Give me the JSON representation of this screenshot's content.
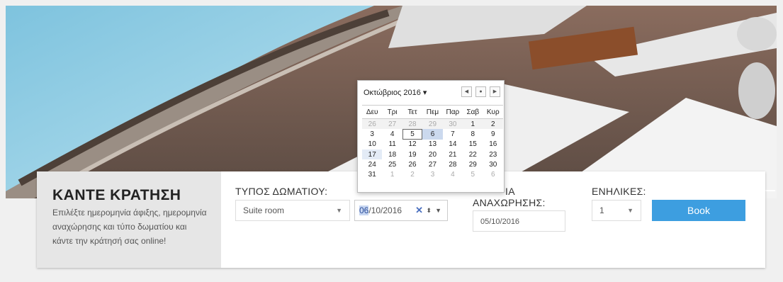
{
  "booking": {
    "title": "ΚΑΝΤΕ ΚΡΑΤΗΣΗ",
    "description": "Επιλέξτε ημερομηνία άφιξης, ημερομηνία αναχώρησης και τύπο δωματίου και κάντε την κράτησή σας online!",
    "room_type_label": "ΤΥΠΟΣ ΔΩΜΑΤΙΟΥ:",
    "room_type_value": "Suite room",
    "arrival_date_day": "06",
    "arrival_date_rest": "/10/2016",
    "departure_label_line1": "ΙΑ",
    "departure_label_line2": "ΑΝΑΧΩΡΗΣΗΣ:",
    "departure_value": "05/10/2016",
    "adults_label": "ΕΝΗΛΙΚΕΣ:",
    "adults_value": "1",
    "book_label": "Book"
  },
  "calendar": {
    "month_label": "Οκτώβριος 2016 ▾",
    "weekdays": [
      "Δευ",
      "Τρι",
      "Τετ",
      "Πεμ",
      "Παρ",
      "Σαβ",
      "Κυρ"
    ],
    "weeks": [
      [
        "26",
        "27",
        "28",
        "29",
        "30",
        "1",
        "2"
      ],
      [
        "3",
        "4",
        "5",
        "6",
        "7",
        "8",
        "9"
      ],
      [
        "10",
        "11",
        "12",
        "13",
        "14",
        "15",
        "16"
      ],
      [
        "17",
        "18",
        "19",
        "20",
        "21",
        "22",
        "23"
      ],
      [
        "24",
        "25",
        "26",
        "27",
        "28",
        "29",
        "30"
      ],
      [
        "31",
        "1",
        "2",
        "3",
        "4",
        "5",
        "6"
      ]
    ]
  },
  "icons": {
    "prev": "chevron-left-icon",
    "today": "dot-icon",
    "next": "chevron-right-icon"
  }
}
